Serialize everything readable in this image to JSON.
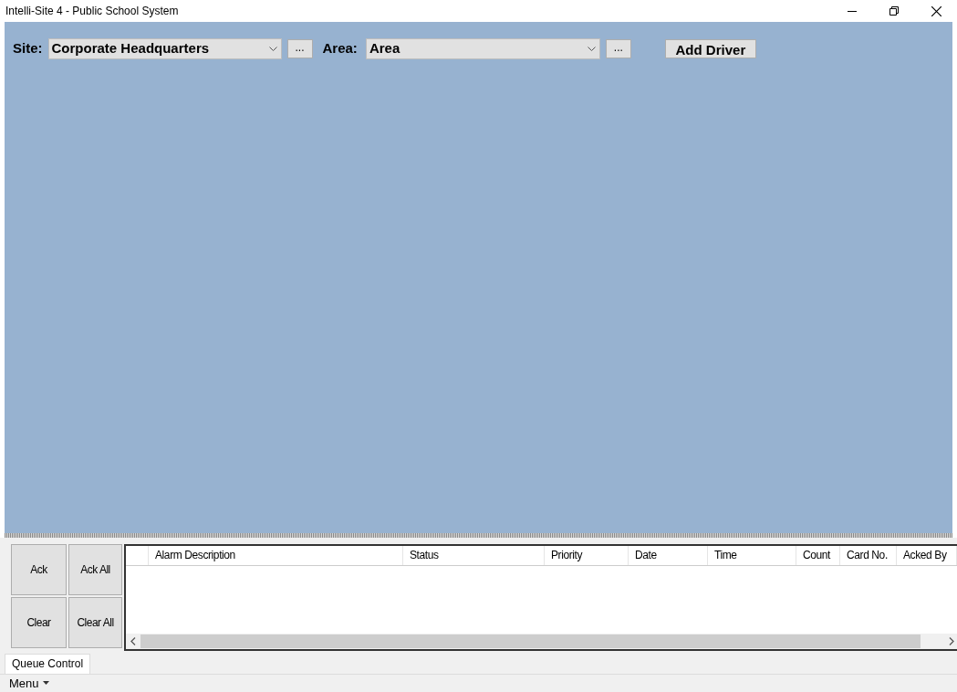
{
  "window": {
    "title": "Intelli-Site 4 - Public School System"
  },
  "toolbar": {
    "site_label": "Site:",
    "site_value": "Corporate Headquarters",
    "site_more": "...",
    "area_label": "Area:",
    "area_value": "Area",
    "area_more": "...",
    "add_button": "Add Driver"
  },
  "queue_buttons": [
    "Ack",
    "Ack All",
    "Clear",
    "Clear All"
  ],
  "alarm_table": {
    "columns": [
      "Alarm Description",
      "Status",
      "Priority",
      "Date",
      "Time",
      "Count",
      "Card No.",
      "Acked By"
    ]
  },
  "tabs": [
    {
      "label": "Queue Control",
      "selected": true
    }
  ],
  "menu": {
    "label": "Menu"
  }
}
